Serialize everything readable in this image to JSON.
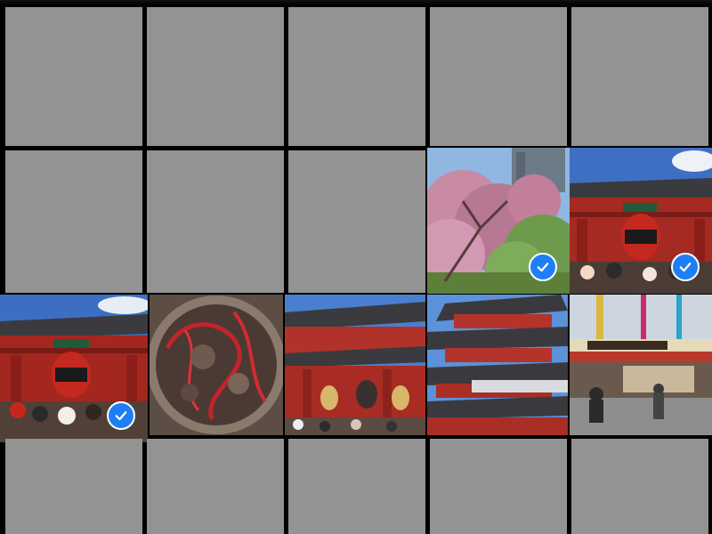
{
  "app": {
    "view": "photo-grid"
  },
  "colors": {
    "selection": "#ff2a10",
    "checkmark": "#1f7ef6",
    "placeholder": "#939393"
  },
  "grid": {
    "rows": [
      {
        "tiles": [
          {
            "name": "photo-r1c1",
            "loaded": false,
            "selected": false
          },
          {
            "name": "photo-r1c2",
            "loaded": false,
            "selected": false
          },
          {
            "name": "photo-r1c3",
            "loaded": false,
            "selected": false
          },
          {
            "name": "photo-r1c4",
            "loaded": false,
            "selected": false
          },
          {
            "name": "photo-r1c5",
            "loaded": false,
            "selected": false
          }
        ]
      },
      {
        "tiles": [
          {
            "name": "photo-r2c1",
            "loaded": false,
            "selected": false
          },
          {
            "name": "photo-r2c2",
            "loaded": false,
            "selected": false
          },
          {
            "name": "photo-r2c3",
            "loaded": false,
            "selected": false
          },
          {
            "name": "photo-r2c4-cherry-blossom",
            "loaded": true,
            "selected": true,
            "subject": "cherry-blossom-tree"
          },
          {
            "name": "photo-r2c5-kaminarimon",
            "loaded": true,
            "selected": true,
            "subject": "temple-gate-lantern"
          }
        ]
      },
      {
        "tiles": [
          {
            "name": "photo-r3c1-kaminarimon",
            "loaded": true,
            "selected": true,
            "subject": "temple-gate-lantern"
          },
          {
            "name": "photo-r3c2-dragon-plate",
            "loaded": true,
            "selected": false,
            "subject": "dragon-carving"
          },
          {
            "name": "photo-r3c3-hozomon",
            "loaded": true,
            "selected": false,
            "subject": "temple-gate"
          },
          {
            "name": "photo-r3c4-pagoda",
            "loaded": true,
            "selected": false,
            "subject": "five-story-pagoda"
          },
          {
            "name": "photo-r3c5-street",
            "loaded": true,
            "selected": false,
            "subject": "shop-street"
          }
        ]
      },
      {
        "tiles": [
          {
            "name": "photo-r4c1",
            "loaded": false,
            "selected": false
          },
          {
            "name": "photo-r4c2",
            "loaded": false,
            "selected": false
          },
          {
            "name": "photo-r4c3",
            "loaded": false,
            "selected": false
          },
          {
            "name": "photo-r4c4",
            "loaded": false,
            "selected": false
          },
          {
            "name": "photo-r4c5",
            "loaded": false,
            "selected": false
          }
        ]
      }
    ]
  },
  "icons": {
    "check": "checkmark-icon"
  }
}
